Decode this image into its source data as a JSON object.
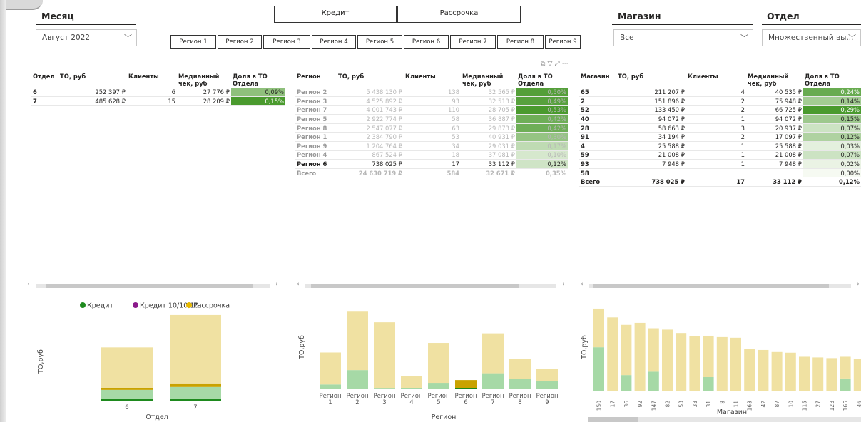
{
  "colors": {
    "kredit": "#1e8a1e",
    "kredit101010": "#8b1a8b",
    "rassrochka": "#e6b800",
    "bar_yellow": "#f0e1a2",
    "bar_green": "#a6d9a6",
    "bar_gold": "#c9a200",
    "dark_green": "#4a9a2e"
  },
  "month": {
    "title": "Месяц",
    "value": "Август 2022"
  },
  "store": {
    "title": "Магазин",
    "value": "Все"
  },
  "dept": {
    "title": "Отдел",
    "value": "Множественный вы..."
  },
  "type_buttons": [
    "Кредит",
    "Рассрочка"
  ],
  "region_buttons": [
    "Регион 1",
    "Регион 2",
    "Регион 3",
    "Регион 4",
    "Регион 5",
    "Регион 6",
    "Регион 7",
    "Регион 8",
    "Регион 9"
  ],
  "table1": {
    "headers": [
      "Отдел",
      "ТО, руб",
      "Клиенты",
      "Медианный чек, руб",
      "Доля в ТО Отдела"
    ],
    "rows": [
      [
        "6",
        "252 397 ₽",
        "6",
        "27 776 ₽",
        "0,09%"
      ],
      [
        "7",
        "485 628 ₽",
        "15",
        "28 209 ₽",
        "0,15%"
      ]
    ],
    "shares": [
      0.09,
      0.15
    ]
  },
  "table2": {
    "headers": [
      "Регион",
      "ТО, руб",
      "Клиенты",
      "Медианный чек, руб",
      "Доля в ТО Отдела"
    ],
    "rows": [
      [
        "Регион 2",
        "5 438 130 ₽",
        "138",
        "32 565 ₽",
        "0,50%"
      ],
      [
        "Регион 3",
        "4 525 892 ₽",
        "93",
        "32 513 ₽",
        "0,49%"
      ],
      [
        "Регион 7",
        "4 001 743 ₽",
        "110",
        "28 705 ₽",
        "0,53%"
      ],
      [
        "Регион 5",
        "2 922 774 ₽",
        "58",
        "36 887 ₽",
        "0,42%"
      ],
      [
        "Регион 8",
        "2 547 077 ₽",
        "63",
        "29 873 ₽",
        "0,42%"
      ],
      [
        "Регион 1",
        "2 384 790 ₽",
        "53",
        "40 931 ₽",
        "0,30%"
      ],
      [
        "Регион 9",
        "1 204 764 ₽",
        "34",
        "29 031 ₽",
        "0,17%"
      ],
      [
        "Регион 4",
        "867 524 ₽",
        "18",
        "37 081 ₽",
        "0,10%"
      ],
      [
        "Регион 6",
        "738 025 ₽",
        "17",
        "33 112 ₽",
        "0,12%"
      ]
    ],
    "total": [
      "Всего",
      "24 630 719 ₽",
      "584",
      "32 671 ₽",
      "0,35%"
    ],
    "shares": [
      0.5,
      0.49,
      0.53,
      0.42,
      0.42,
      0.3,
      0.17,
      0.1,
      0.12
    ]
  },
  "table3": {
    "headers": [
      "Магазин",
      "ТО, руб",
      "Клиенты",
      "Медианный чек, руб",
      "Доля в ТО Отдела"
    ],
    "rows": [
      [
        "65",
        "211 207 ₽",
        "4",
        "40 535 ₽",
        "0,24%"
      ],
      [
        "2",
        "151 896 ₽",
        "2",
        "75 948 ₽",
        "0,14%"
      ],
      [
        "52",
        "133 450 ₽",
        "2",
        "66 725 ₽",
        "0,29%"
      ],
      [
        "40",
        "94 072 ₽",
        "1",
        "94 072 ₽",
        "0,15%"
      ],
      [
        "28",
        "58 663 ₽",
        "3",
        "20 937 ₽",
        "0,07%"
      ],
      [
        "91",
        "34 194 ₽",
        "2",
        "17 097 ₽",
        "0,12%"
      ],
      [
        "4",
        "25 588 ₽",
        "1",
        "25 588 ₽",
        "0,03%"
      ],
      [
        "59",
        "21 008 ₽",
        "1",
        "21 008 ₽",
        "0,07%"
      ],
      [
        "93",
        "7 948 ₽",
        "1",
        "7 948 ₽",
        "0,02%"
      ],
      [
        "58",
        "",
        "",
        "",
        "0,00%"
      ]
    ],
    "total": [
      "Всего",
      "738 025 ₽",
      "17",
      "33 112 ₽",
      "0,12%"
    ],
    "shares": [
      0.24,
      0.14,
      0.29,
      0.15,
      0.07,
      0.12,
      0.03,
      0.07,
      0.02,
      0.0
    ]
  },
  "chart_data": [
    {
      "type": "bar",
      "stacked": true,
      "xlabel": "Отдел",
      "ylabel": "ТО,руб",
      "legend": [
        "Кредит",
        "Кредит 10/10/10",
        "Рассрочка"
      ],
      "categories": [
        "6",
        "7"
      ],
      "series": [
        {
          "name": "Кредит",
          "values": [
            2,
            4
          ]
        },
        {
          "name": "Кредит 10/10/10",
          "values": [
            0,
            0
          ]
        },
        {
          "name": "Рассрочка",
          "values": [
            57,
            102
          ]
        },
        {
          "name": "",
          "values": [
            2,
            5
          ]
        }
      ]
    },
    {
      "type": "bar",
      "stacked": true,
      "xlabel": "Регион",
      "ylabel": "ТО,руб",
      "categories": [
        "Регион 1",
        "Регион 2",
        "Регион 3",
        "Регион 4",
        "Регион 5",
        "Регион 6",
        "Регион 7",
        "Регион 8",
        "Регион 9"
      ],
      "tick_lines": [
        [
          "Регион",
          "1"
        ],
        [
          "Регион",
          "2"
        ],
        [
          "Регион",
          "3"
        ],
        [
          "Регион",
          "4"
        ],
        [
          "Регион",
          "5"
        ],
        [
          "Регион",
          "6"
        ],
        [
          "Регион",
          "7"
        ],
        [
          "Регион",
          "8"
        ],
        [
          "Регион",
          "9"
        ]
      ],
      "series": [
        {
          "name": "",
          "values": [
            6,
            24,
            0.8,
            1.5,
            8,
            1.5,
            20,
            13,
            10
          ]
        },
        {
          "name": "",
          "values": [
            40,
            74,
            83,
            15,
            50,
            0,
            50,
            25,
            15
          ]
        },
        {
          "name": "",
          "values": [
            0,
            0,
            0,
            0,
            0,
            10,
            0,
            0,
            0
          ]
        }
      ]
    },
    {
      "type": "bar",
      "stacked": true,
      "xlabel": "Магазин",
      "ylabel": "ТО,руб",
      "categories": [
        "150",
        "17",
        "36",
        "92",
        "147",
        "82",
        "53",
        "33",
        "31",
        "8",
        "11",
        "163",
        "42",
        "87",
        "10",
        "115",
        "27",
        "123",
        "165",
        "46"
      ],
      "series": [
        {
          "name": "",
          "values": [
            64,
            0,
            23,
            0,
            28,
            0,
            0,
            0,
            20,
            0,
            0,
            0,
            0,
            0,
            0,
            0,
            0,
            0,
            18,
            0
          ]
        },
        {
          "name": "",
          "values": [
            57,
            108,
            74,
            100,
            64,
            90,
            85,
            80,
            61,
            79,
            78,
            62,
            60,
            57,
            56,
            50,
            49,
            48,
            32,
            47
          ]
        }
      ]
    }
  ]
}
